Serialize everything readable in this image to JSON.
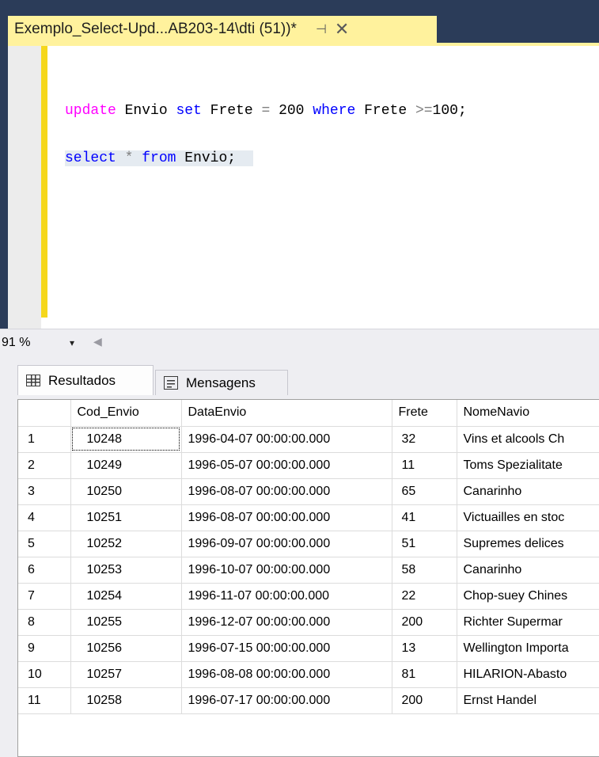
{
  "tab": {
    "title": "Exemplo_Select-Upd...AB203-14\\dti (51))*",
    "pin_glyph": "⊣",
    "close_glyph": "✕"
  },
  "editor": {
    "line1": {
      "kw1": "update",
      "t1": " Envio ",
      "kw2": "set",
      "t2": " Frete ",
      "op1": "=",
      "t3": " 200 ",
      "kw3": "where",
      "t4": " Frete ",
      "op2": ">=",
      "t5": "100;"
    },
    "line2": {
      "kw1": "select",
      "t1": " ",
      "op1": "*",
      "t2": " ",
      "kw2": "from",
      "t3": " Envio;"
    }
  },
  "status": {
    "zoom": "91 %",
    "zoom_arrow": "▾",
    "scroll_glyph": "◀"
  },
  "results_tabs": {
    "results": "Resultados",
    "messages": "Mensagens"
  },
  "grid": {
    "columns": [
      "",
      "Cod_Envio",
      "DataEnvio",
      "Frete",
      "NomeNavio"
    ],
    "rows": [
      [
        "1",
        "10248",
        "1996-04-07 00:00:00.000",
        "32",
        "Vins et alcools Ch"
      ],
      [
        "2",
        "10249",
        "1996-05-07 00:00:00.000",
        "11",
        "Toms Spezialitate"
      ],
      [
        "3",
        "10250",
        "1996-08-07 00:00:00.000",
        "65",
        "Canarinho"
      ],
      [
        "4",
        "10251",
        "1996-08-07 00:00:00.000",
        "41",
        "Victuailles en stoc"
      ],
      [
        "5",
        "10252",
        "1996-09-07 00:00:00.000",
        "51",
        "Supremes delices"
      ],
      [
        "6",
        "10253",
        "1996-10-07 00:00:00.000",
        "58",
        "Canarinho"
      ],
      [
        "7",
        "10254",
        "1996-11-07 00:00:00.000",
        "22",
        "Chop-suey Chines"
      ],
      [
        "8",
        "10255",
        "1996-12-07 00:00:00.000",
        "200",
        "Richter Supermar"
      ],
      [
        "9",
        "10256",
        "1996-07-15 00:00:00.000",
        "13",
        "Wellington Importa"
      ],
      [
        "10",
        "10257",
        "1996-08-08 00:00:00.000",
        "81",
        "HILARION-Abasto"
      ],
      [
        "11",
        "10258",
        "1996-07-17 00:00:00.000",
        "200",
        "Ernst Handel"
      ]
    ]
  },
  "colors": {
    "frame": "#2b3c59",
    "tab_active": "#fff29d",
    "change_bar": "#f5d71c",
    "keyword_blue": "#0000ff",
    "keyword_pink": "#ff00ff",
    "operator_gray": "#808080",
    "line_highlight": "#e5ebf1",
    "panel_bg": "#eeeef2"
  },
  "icons": {
    "tab_pin": "pin-icon",
    "tab_close": "close-icon",
    "results_tab": "grid-icon",
    "messages_tab": "messages-icon"
  }
}
